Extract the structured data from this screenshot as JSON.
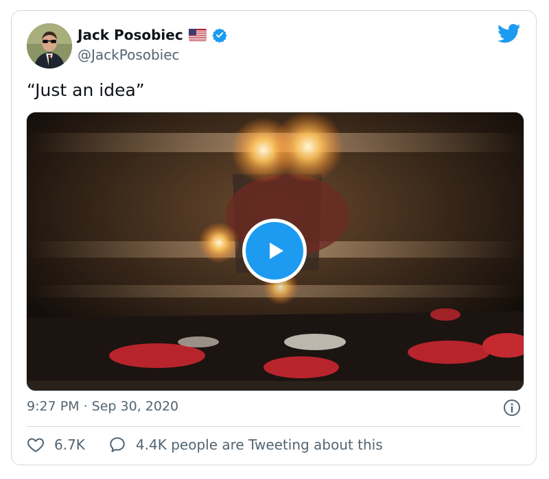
{
  "author": {
    "display_name": "Jack Posobiec",
    "handle": "@JackPosobiec",
    "flag_icon": "us-flag-icon",
    "verified_icon": "verified-badge-icon",
    "verified_color": "#1d9bf0"
  },
  "brand": {
    "icon": "twitter-bird-icon",
    "color": "#1d9bf0"
  },
  "tweet": {
    "text": "“Just an idea”",
    "timestamp": "9:27 PM · Sep 30, 2020"
  },
  "media": {
    "type": "video",
    "play_icon": "play-icon"
  },
  "actions": {
    "like_icon": "heart-icon",
    "like_count": "6.7K",
    "reply_icon": "speech-bubble-icon",
    "tweeting_text": "4.4K people are Tweeting about this"
  },
  "info_icon": "info-icon"
}
